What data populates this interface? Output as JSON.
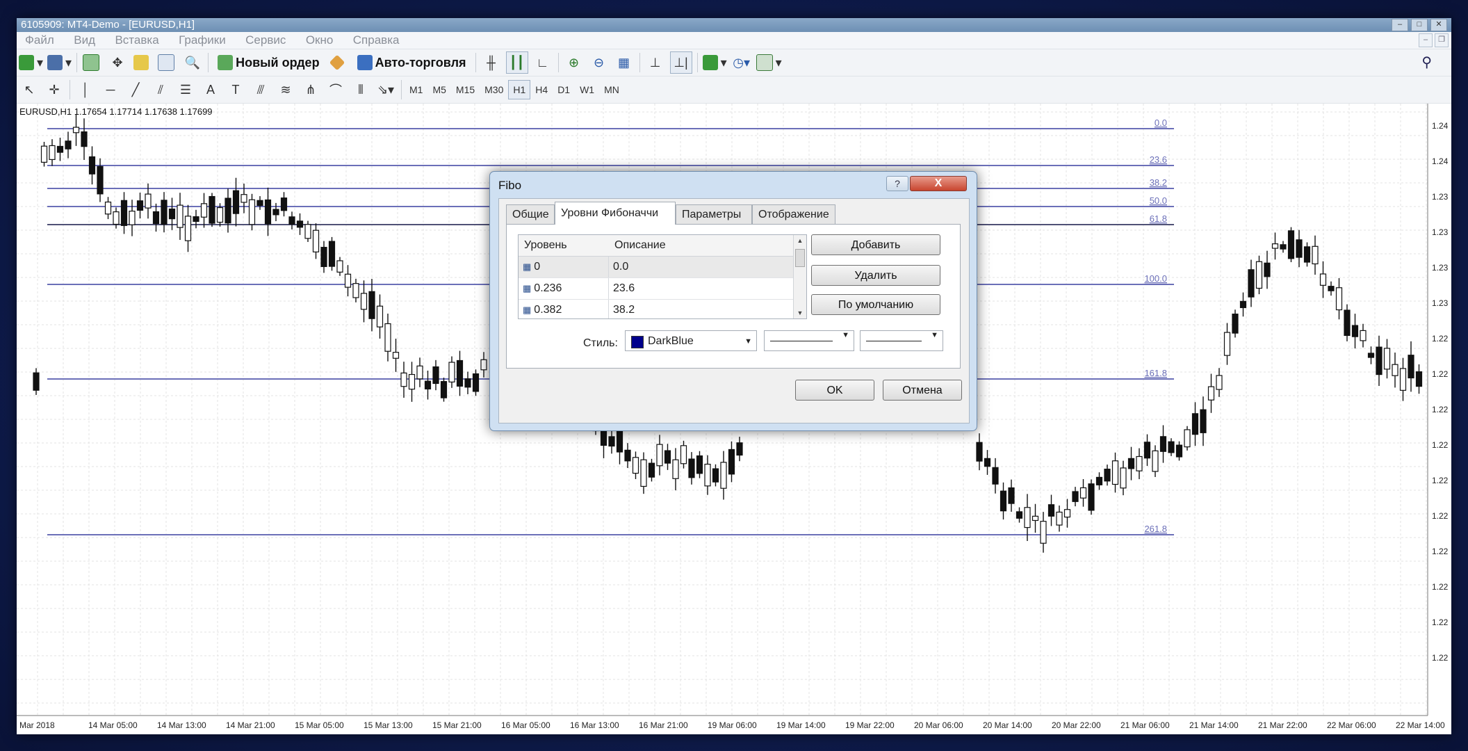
{
  "window": {
    "title": "6105909: MT4-Demo - [EURUSD,H1]"
  },
  "menu": [
    "Файл",
    "Вид",
    "Вставка",
    "Графики",
    "Сервис",
    "Окно",
    "Справка"
  ],
  "toolbar1": {
    "new_order": "Новый ордер",
    "auto_trading": "Авто-торговля"
  },
  "timeframes": [
    "M1",
    "M5",
    "M15",
    "M30",
    "H1",
    "H4",
    "D1",
    "W1",
    "MN"
  ],
  "active_timeframe": "H1",
  "toolbar2": {
    "text_tool": "A"
  },
  "chart": {
    "symbol_info": "EURUSD,H1  1.17654 1.17714 1.17638 1.17699",
    "fib_labels": [
      "0.0",
      "23.6",
      "38.2",
      "50.0",
      "61.8",
      "100.0",
      "161.8",
      "261.8"
    ],
    "price_labels": [
      "1.24",
      "1.24",
      "1.23",
      "1.23",
      "1.23",
      "1.23",
      "1.22",
      "1.22",
      "1.22",
      "1.22",
      "1.22",
      "1.22",
      "1.22",
      "1.22",
      "1.22",
      "1.22"
    ],
    "time_labels": [
      "Mar 2018",
      "14 Mar 05:00",
      "14 Mar 13:00",
      "14 Mar 21:00",
      "15 Mar 05:00",
      "15 Mar 13:00",
      "15 Mar 21:00",
      "16 Mar 05:00",
      "16 Mar 13:00",
      "16 Mar 21:00",
      "19 Mar 06:00",
      "19 Mar 14:00",
      "19 Mar 22:00",
      "20 Mar 06:00",
      "20 Mar 14:00",
      "20 Mar 22:00",
      "21 Mar 06:00",
      "21 Mar 14:00",
      "21 Mar 22:00",
      "22 Mar 06:00",
      "22 Mar 14:00"
    ],
    "line_color": "#6b6fb8"
  },
  "dialog": {
    "title": "Fibo",
    "help": "?",
    "close": "X",
    "tabs": [
      "Общие",
      "Уровни Фибоначчи",
      "Параметры",
      "Отображение"
    ],
    "active_tab": "Уровни Фибоначчи",
    "table": {
      "headers": [
        "Уровень",
        "Описание"
      ],
      "rows": [
        {
          "level": "0",
          "description": "0.0"
        },
        {
          "level": "0.236",
          "description": "23.6"
        },
        {
          "level": "0.382",
          "description": "38.2"
        }
      ]
    },
    "buttons": {
      "add": "Добавить",
      "delete": "Удалить",
      "default": "По умолчанию",
      "ok": "OK",
      "cancel": "Отмена"
    },
    "style_label": "Стиль:",
    "color_value": "DarkBlue",
    "color_hex": "#00008b"
  }
}
